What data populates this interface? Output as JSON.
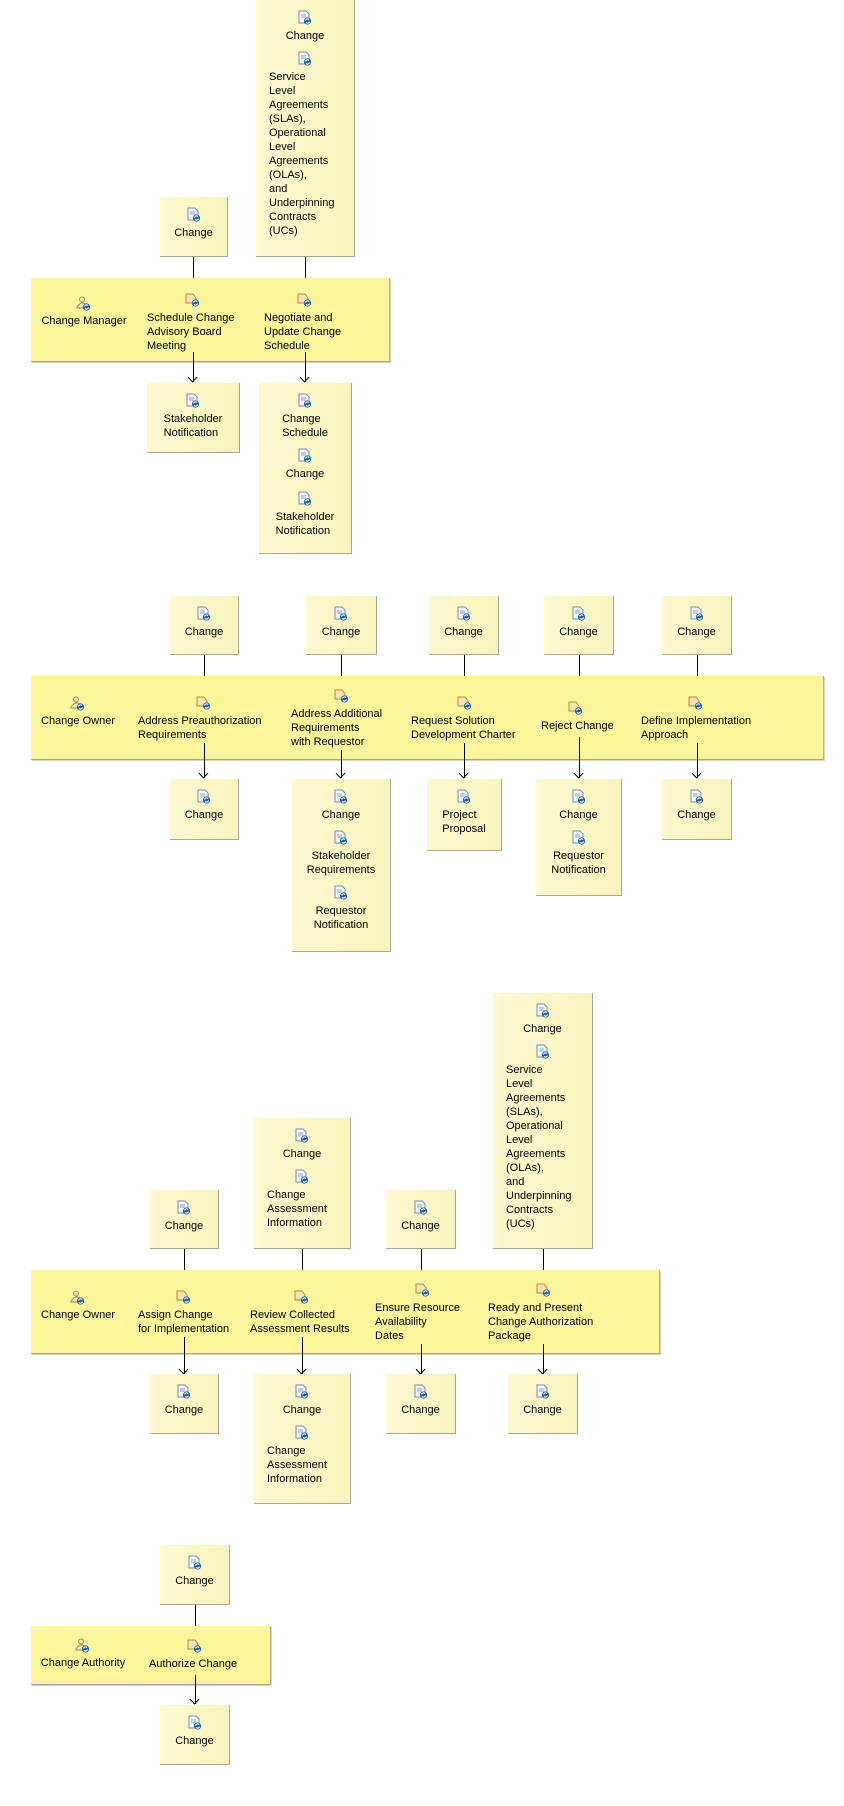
{
  "colors": {
    "lane": "#fbf59c",
    "workproduct": "#fbf7c4",
    "icon_blue": "#1f5f9c",
    "task_orange": "#d49a3a"
  },
  "lanes": [
    {
      "role": "Change Manager",
      "tasks": [
        {
          "name": "Schedule Change Advisory Board Meeting",
          "label": "Schedule Change\nAdvisory Board\nMeeting",
          "inputs": [
            "Change"
          ],
          "outputs": [
            "Stakeholder Notification"
          ]
        },
        {
          "name": "Negotiate and Update Change Schedule",
          "label": "Negotiate and\nUpdate Change\nSchedule",
          "inputs": [
            "Change",
            "Service Level Agreements (SLAs), Operational Level Agreements (OLAs), and Underpinning Contracts (UCs)"
          ],
          "outputs": [
            "Change Schedule",
            "Change",
            "Stakeholder Notification"
          ]
        }
      ]
    },
    {
      "role": "Change Owner",
      "tasks": [
        {
          "name": "Address Preauthorization Requirements",
          "label": "Address Preauthorization\nRequirements",
          "inputs": [
            "Change"
          ],
          "outputs": [
            "Change"
          ]
        },
        {
          "name": "Address Additional Requirements with Requestor",
          "label": "Address Additional\nRequirements\nwith Requestor",
          "inputs": [
            "Change"
          ],
          "outputs": [
            "Change",
            "Stakeholder Requirements",
            "Requestor Notification"
          ]
        },
        {
          "name": "Request Solution Development Charter",
          "label": "Request Solution\nDevelopment Charter",
          "inputs": [
            "Change"
          ],
          "outputs": [
            "Project Proposal"
          ]
        },
        {
          "name": "Reject Change",
          "label": "Reject Change",
          "inputs": [
            "Change"
          ],
          "outputs": [
            "Change",
            "Requestor Notification"
          ]
        },
        {
          "name": "Define Implementation Approach",
          "label": "Define Implementation\nApproach",
          "inputs": [
            "Change"
          ],
          "outputs": [
            "Change"
          ]
        }
      ]
    },
    {
      "role": "Change Owner",
      "tasks": [
        {
          "name": "Assign Change for Implementation",
          "label": "Assign Change\nfor Implementation",
          "inputs": [
            "Change"
          ],
          "outputs": [
            "Change"
          ]
        },
        {
          "name": "Review Collected Assessment Results",
          "label": "Review Collected\nAssessment Results",
          "inputs": [
            "Change",
            "Change Assessment Information"
          ],
          "outputs": [
            "Change",
            "Change Assessment Information"
          ]
        },
        {
          "name": "Ensure Resource Availability Dates",
          "label": "Ensure Resource\nAvailability\nDates",
          "inputs": [
            "Change"
          ],
          "outputs": [
            "Change"
          ]
        },
        {
          "name": "Ready and Present Change Authorization Package",
          "label": "Ready and Present\nChange Authorization\nPackage",
          "inputs": [
            "Change",
            "Service Level Agreements (SLAs), Operational Level Agreements (OLAs), and Underpinning Contracts (UCs)"
          ],
          "outputs": [
            "Change"
          ]
        }
      ]
    },
    {
      "role": "Change Authority",
      "tasks": [
        {
          "name": "Authorize Change",
          "label": "Authorize Change",
          "inputs": [
            "Change"
          ],
          "outputs": [
            "Change"
          ]
        }
      ]
    }
  ],
  "wrapped_labels": {
    "sla": "Service\nLevel\nAgreements\n(SLAs),\nOperational\nLevel\nAgreements\n(OLAs),\nand\nUnderpinning\nContracts\n(UCs)",
    "stakeholder_notification": "Stakeholder\nNotification",
    "change_schedule": "Change\nSchedule",
    "stakeholder_requirements": "Stakeholder\nRequirements",
    "requestor_notification": "Requestor\nNotification",
    "project_proposal": "Project\nProposal",
    "change_assessment_information": "Change\nAssessment\nInformation"
  }
}
